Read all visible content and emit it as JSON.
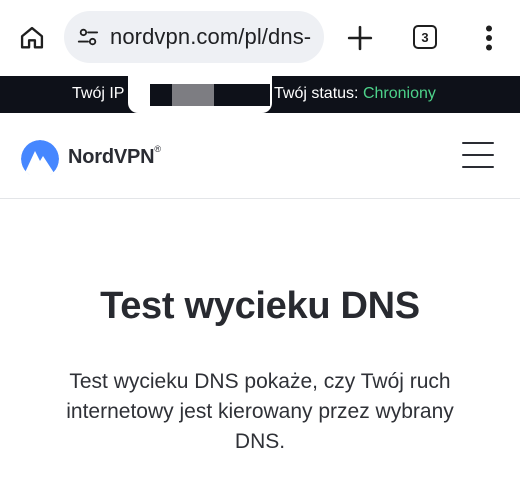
{
  "browser": {
    "url": "nordvpn.com/pl/dns-",
    "tab_count": "3",
    "icons": {
      "home": "home-icon",
      "site_settings": "tune-icon",
      "new_tab": "plus-icon",
      "menu": "more-vert-icon"
    }
  },
  "ip_bar": {
    "ip_label": "Twój IP",
    "status_label": "Twój status:",
    "status_value": "Chroniony",
    "status_color": "#4dd28a"
  },
  "header": {
    "brand": "NordVPN",
    "brand_mark": "®",
    "brand_color": "#4687ff",
    "menu_icon": "hamburger-menu-icon"
  },
  "main": {
    "title": "Test wycieku DNS",
    "description": "Test wycieku DNS pokaże, czy Twój ruch internetowy jest kierowany przez wybrany DNS."
  }
}
